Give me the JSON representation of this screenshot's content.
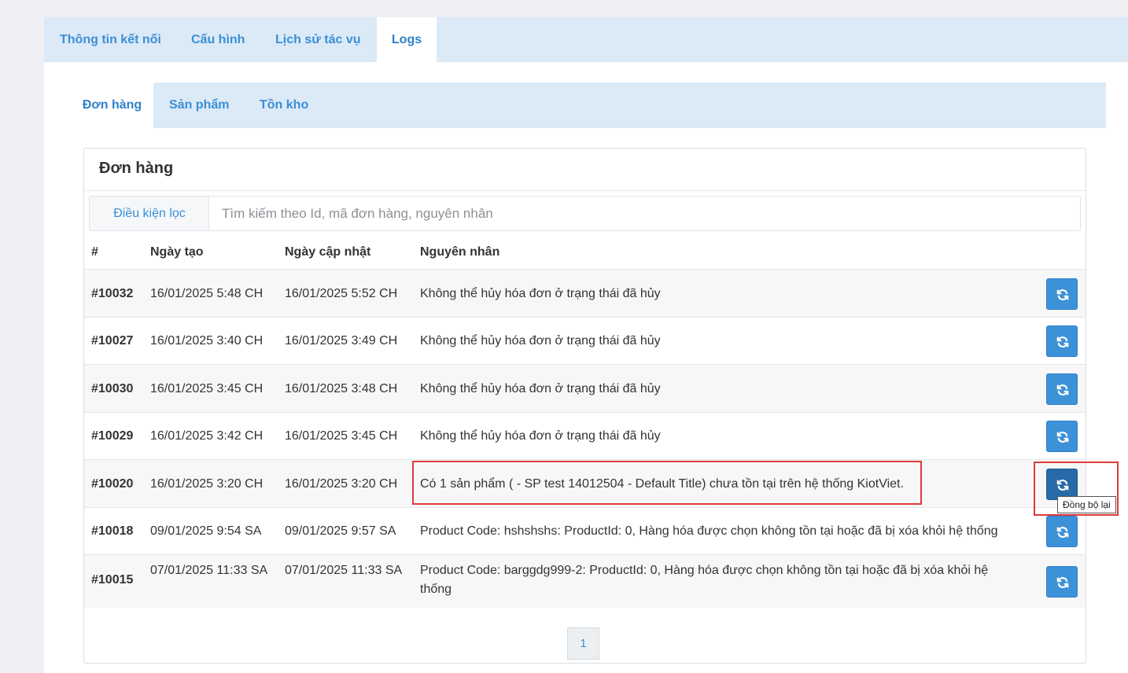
{
  "top_tabs": [
    "Thông tin kết nối",
    "Cấu hình",
    "Lịch sử tác vụ",
    "Logs"
  ],
  "sub_tabs": [
    "Đơn hàng",
    "Sản phẩm",
    "Tồn kho"
  ],
  "panel": {
    "title": "Đơn hàng",
    "filter_label": "Điều kiện lọc",
    "search_placeholder": "Tìm kiếm theo Id, mã đơn hàng, nguyên nhân"
  },
  "table": {
    "headers": [
      "#",
      "Ngày tạo",
      "Ngày cập nhật",
      "Nguyên nhân"
    ],
    "rows": [
      {
        "id": "#10032",
        "created": "16/01/2025 5:48 CH",
        "updated": "16/01/2025 5:52 CH",
        "reason": "Không thể hủy hóa đơn ở trạng thái đã hủy"
      },
      {
        "id": "#10027",
        "created": "16/01/2025 3:40 CH",
        "updated": "16/01/2025 3:49 CH",
        "reason": "Không thể hủy hóa đơn ở trạng thái đã hủy"
      },
      {
        "id": "#10030",
        "created": "16/01/2025 3:45 CH",
        "updated": "16/01/2025 3:48 CH",
        "reason": "Không thể hủy hóa đơn ở trạng thái đã hủy"
      },
      {
        "id": "#10029",
        "created": "16/01/2025 3:42 CH",
        "updated": "16/01/2025 3:45 CH",
        "reason": "Không thể hủy hóa đơn ở trạng thái đã hủy"
      },
      {
        "id": "#10020",
        "created": "16/01/2025 3:20 CH",
        "updated": "16/01/2025 3:20 CH",
        "reason": "Có 1 sản phẩm ( - SP test 14012504 - Default Title) chưa tồn tại trên hệ thống KiotViet."
      },
      {
        "id": "#10018",
        "created": "09/01/2025 9:54 SA",
        "updated": "09/01/2025 9:57 SA",
        "reason": "Product Code: hshshshs: ProductId: 0, Hàng hóa được chọn không tồn tại hoặc đã bị xóa khỏi hệ thống"
      },
      {
        "id": "#10015",
        "created": "07/01/2025 11:33 SA",
        "updated": "07/01/2025 11:33 SA",
        "reason": "Product Code: barggdg999-2: ProductId: 0, Hàng hóa được chọn không tồn tại hoặc đã bị xóa khỏi hệ thống"
      }
    ]
  },
  "tooltip": "Đồng bộ lại",
  "pagination": {
    "current": "1"
  },
  "colors": {
    "accent": "#3d91d8",
    "tab_bg": "#dce9f7",
    "highlight": "#e03a3a"
  },
  "icons": {
    "sync": "refresh-icon"
  }
}
